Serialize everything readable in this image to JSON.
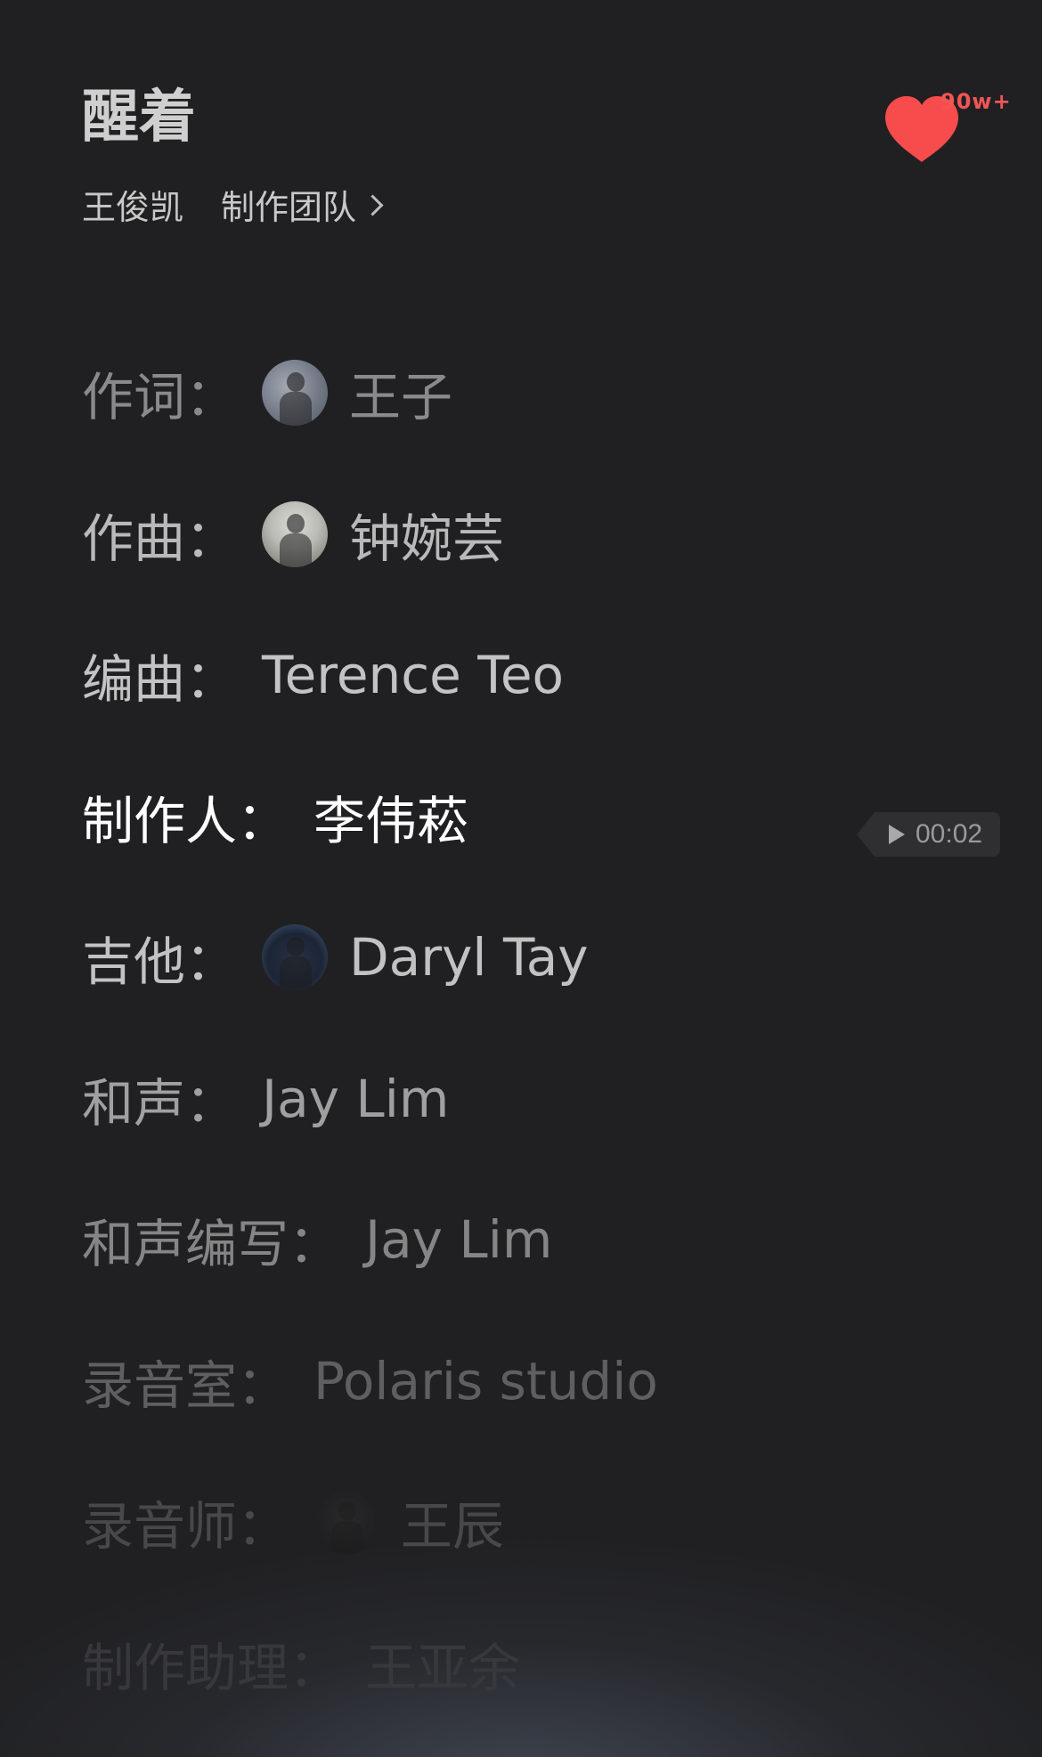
{
  "header": {
    "song_title": "醒着",
    "artist": "王俊凯",
    "team_link": "制作团队"
  },
  "like": {
    "count": "90w+",
    "color": "#f64c4c",
    "icon": "heart-icon"
  },
  "credits": [
    {
      "role": "作词：",
      "name": "王子",
      "avatar": true
    },
    {
      "role": "作曲：",
      "name": "钟婉芸",
      "avatar": true
    },
    {
      "role": "编曲：",
      "name": "Terence Teo",
      "avatar": false
    },
    {
      "role": "制作人：",
      "name": "李伟菘",
      "avatar": false
    },
    {
      "role": "吉他：",
      "name": "Daryl Tay",
      "avatar": true
    },
    {
      "role": "和声：",
      "name": "Jay Lim",
      "avatar": false
    },
    {
      "role": "和声编写：",
      "name": "Jay Lim",
      "avatar": false
    },
    {
      "role": "录音室：",
      "name": "Polaris studio",
      "avatar": false
    },
    {
      "role": "录音师：",
      "name": "王辰",
      "avatar": true
    },
    {
      "role": "制作助理：",
      "name": "王亚余",
      "avatar": false
    }
  ],
  "seek": {
    "time": "00:02",
    "icon": "play-icon"
  }
}
